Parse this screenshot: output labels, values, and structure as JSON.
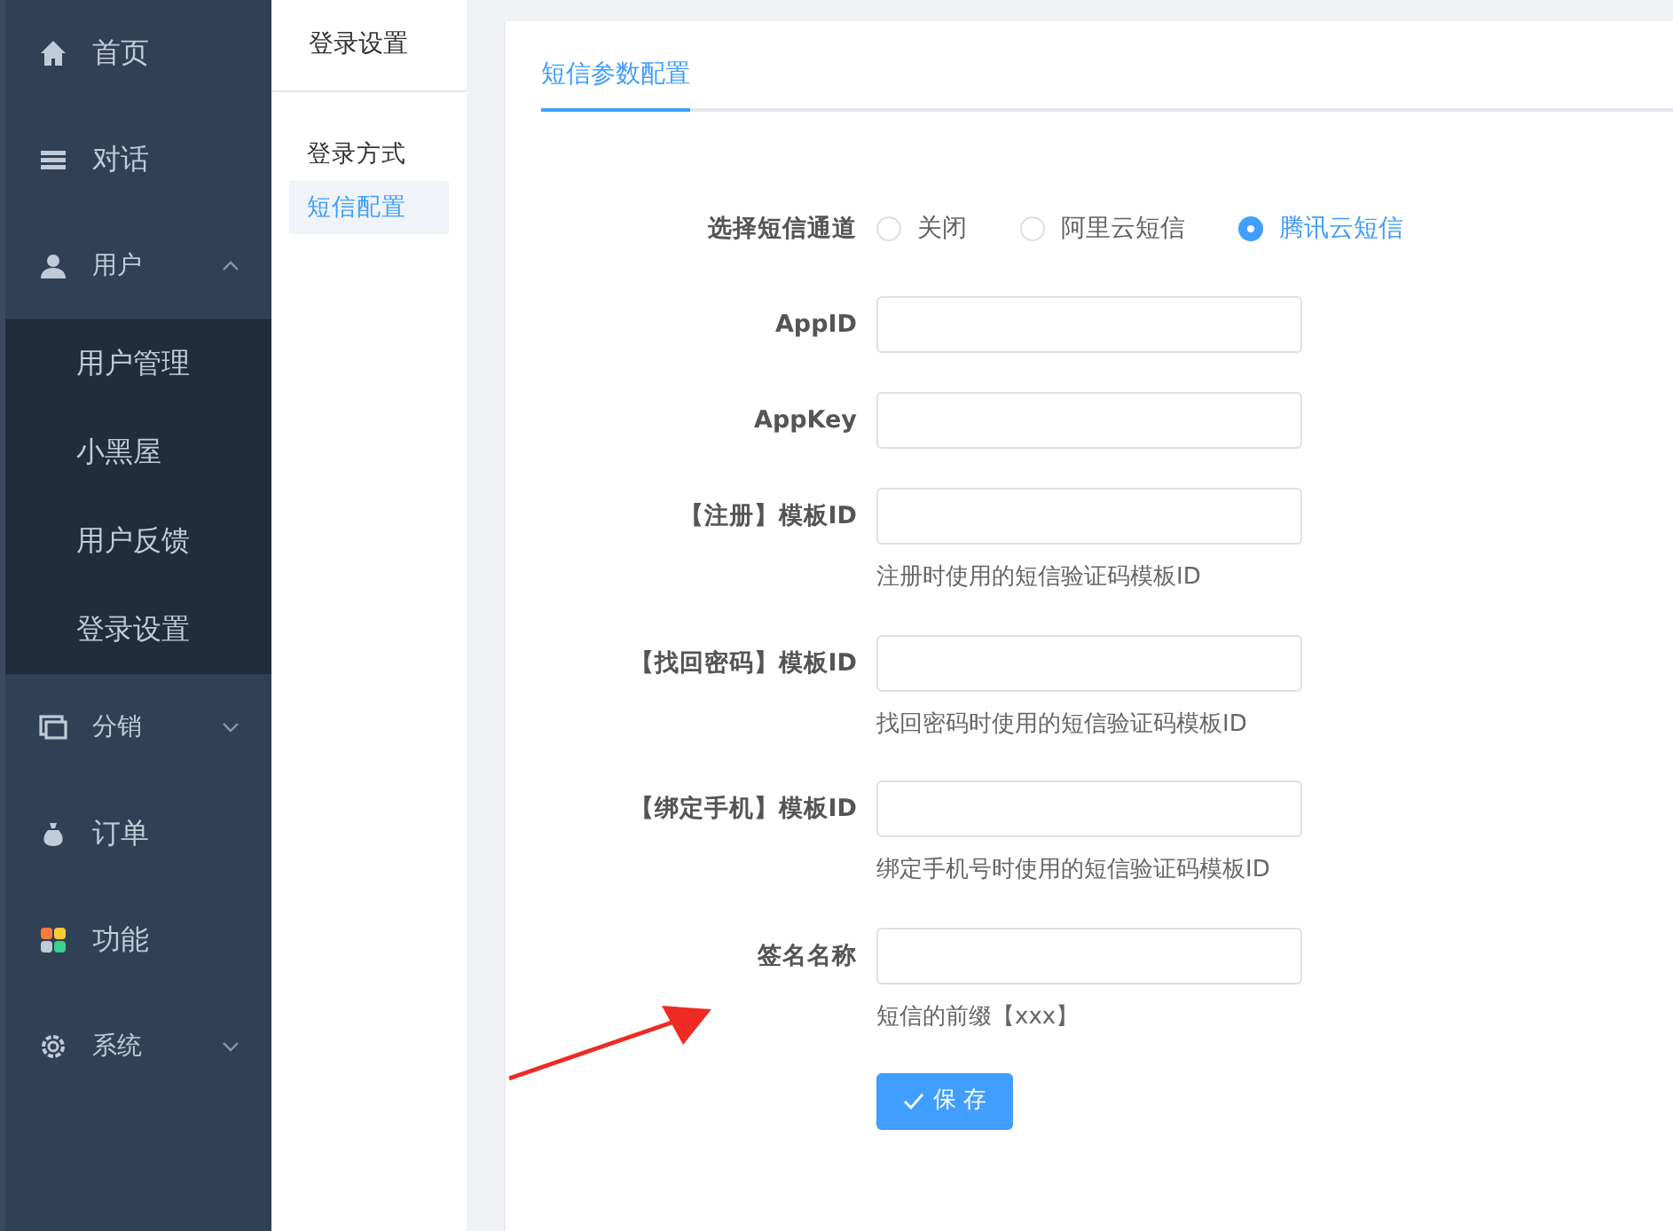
{
  "sidebar": {
    "items": [
      {
        "label": "首页"
      },
      {
        "label": "对话"
      },
      {
        "label": "用户",
        "expanded": true,
        "children": [
          {
            "label": "用户管理"
          },
          {
            "label": "小黑屋"
          },
          {
            "label": "用户反馈"
          },
          {
            "label": "登录设置"
          }
        ]
      },
      {
        "label": "分销",
        "expanded": false
      },
      {
        "label": "订单"
      },
      {
        "label": "功能"
      },
      {
        "label": "系统",
        "expanded": false
      }
    ]
  },
  "submenu": {
    "title": "登录设置",
    "items": [
      {
        "label": "登录方式",
        "selected": false
      },
      {
        "label": "短信配置",
        "selected": true
      }
    ]
  },
  "tabs": [
    {
      "label": "短信参数配置",
      "selected": true
    }
  ],
  "form": {
    "channel": {
      "label": "选择短信通道",
      "options": [
        {
          "label": "关闭",
          "selected": false
        },
        {
          "label": "阿里云短信",
          "selected": false
        },
        {
          "label": "腾讯云短信",
          "selected": true
        }
      ]
    },
    "fields": [
      {
        "label": "AppID"
      },
      {
        "label": "AppKey"
      },
      {
        "label": "【注册】模板ID",
        "hint": "注册时使用的短信验证码模板ID"
      },
      {
        "label": "【找回密码】模板ID",
        "hint": "找回密码时使用的短信验证码模板ID"
      },
      {
        "label": "【绑定手机】模板ID",
        "hint": "绑定手机号时使用的短信验证码模板ID"
      },
      {
        "label": "签名名称",
        "hint": "短信的前缀【xxx】"
      }
    ],
    "save_button": "保 存"
  },
  "annotation": {
    "kind": "arrow"
  }
}
